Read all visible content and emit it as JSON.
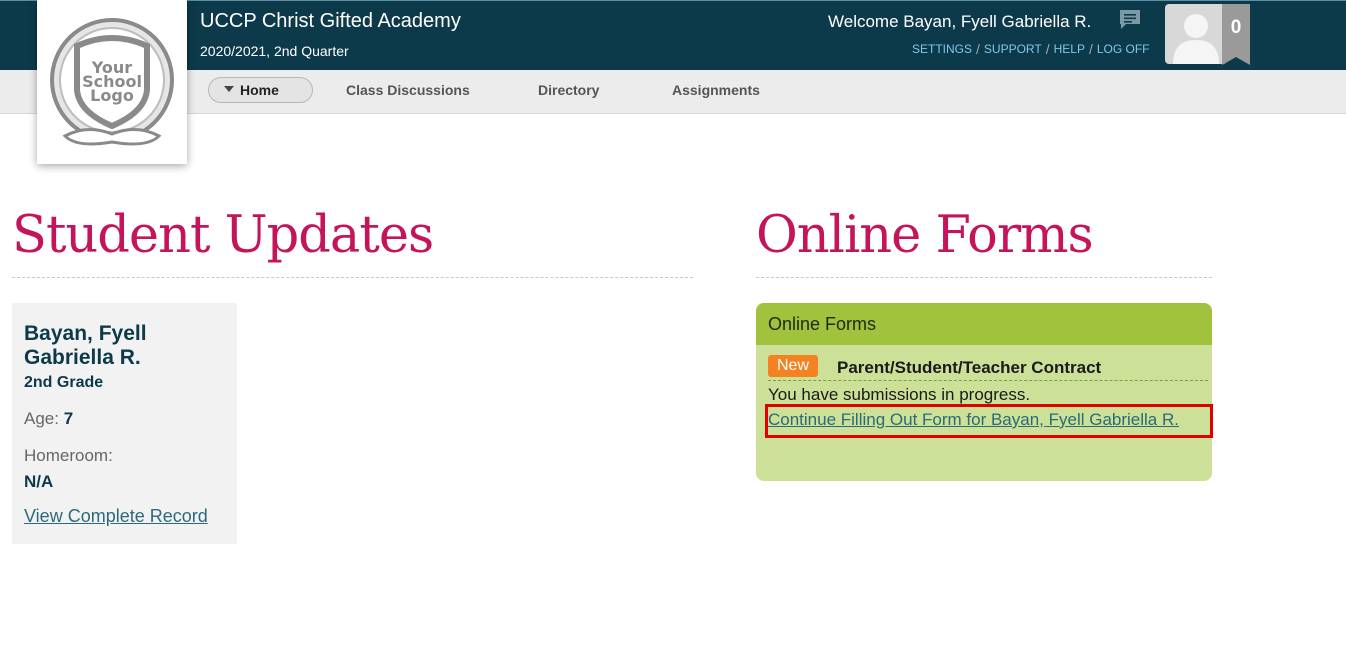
{
  "header": {
    "school_name": "UCCP Christ Gifted Academy",
    "term": "2020/2021, 2nd Quarter",
    "welcome": "Welcome Bayan, Fyell Gabriella R.",
    "links": [
      "SETTINGS",
      "SUPPORT",
      "HELP",
      "LOG OFF"
    ],
    "notification_count": "0"
  },
  "logo": {
    "text_lines": [
      "Your",
      "School",
      "Logo"
    ]
  },
  "nav": {
    "items": [
      "Home",
      "Class Discussions",
      "Directory",
      "Assignments"
    ]
  },
  "student_updates": {
    "title": "Student Updates",
    "card": {
      "name": "Bayan, Fyell Gabriella R.",
      "grade": "2nd Grade",
      "age_label": "Age:",
      "age_value": "7",
      "homeroom_label": "Homeroom:",
      "homeroom_value": "N/A",
      "record_link": "View Complete Record"
    }
  },
  "online_forms": {
    "title": "Online Forms",
    "panel_header": "Online Forms",
    "badge": "New",
    "form_name": "Parent/Student/Teacher Contract",
    "status": "You have submissions in progress.",
    "continue_link": "Continue Filling Out Form for Bayan, Fyell Gabriella R."
  },
  "colors": {
    "header_bg": "#0d3a4a",
    "heading": "#c4145a",
    "link": "#2a6a7a",
    "forms_header": "#a0c23c",
    "forms_body": "#cde098",
    "new_badge": "#f58220",
    "highlight": "#e00000"
  }
}
